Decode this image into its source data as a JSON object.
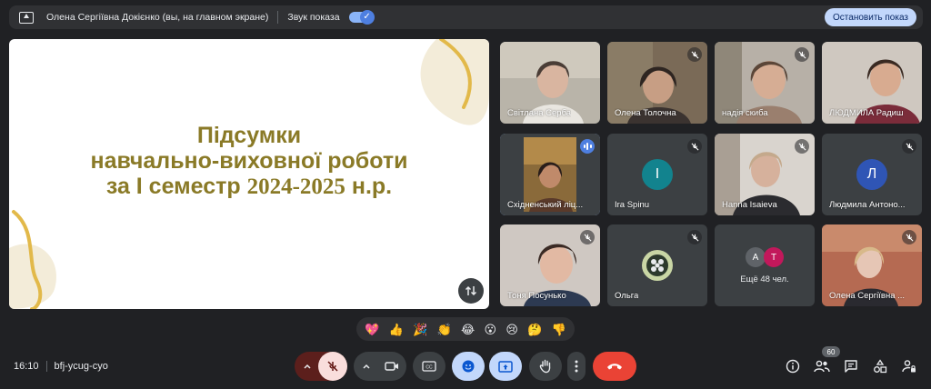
{
  "topbar": {
    "title": "Олена Сергіївна Докієнко (вы, на главном экране)",
    "sound_label": "Звук показа",
    "stop_button": "Остановить показ"
  },
  "slide": {
    "line1": "Підсумки",
    "line2": "навчально-виховної роботи",
    "line3_a": "за І семестр ",
    "line3_year": "2024-2025",
    "line3_b": " н.р.",
    "text_color": "#8a7a27",
    "accent_color": "#e2b94a"
  },
  "participants": [
    {
      "name": "Світлана Серба",
      "muted": false
    },
    {
      "name": "Олена Толочна",
      "muted": true
    },
    {
      "name": "надія скиба",
      "muted": true
    },
    {
      "name": "ЛЮДМИЛА Радиш",
      "muted": false
    },
    {
      "name": "Східненський ліц...",
      "muted": false,
      "speaking": true
    },
    {
      "name": "Ira Spinu",
      "muted": true,
      "initial": "I"
    },
    {
      "name": "Hanna Isaieva",
      "muted": true
    },
    {
      "name": "Людмила Антоно...",
      "muted": true,
      "initial": "Л"
    },
    {
      "name": "Тоня Посунько",
      "muted": true
    },
    {
      "name": "Ольга",
      "muted": true
    },
    {
      "name": "Ещё 48 чел.",
      "initials": [
        "А",
        "Т"
      ]
    },
    {
      "name": "Олена Сергіївна ...",
      "muted": true
    }
  ],
  "reactions": [
    "💖",
    "👍",
    "🎉",
    "👏",
    "😂",
    "😮",
    "😢",
    "🤔",
    "👎"
  ],
  "bottom": {
    "time": "16:10",
    "meeting_code": "bfj-ycug-cyo",
    "people_count": "60"
  },
  "colors": {
    "background": "#202124",
    "tile": "#3c4043",
    "accent_blue": "#8ab4f8",
    "end_call": "#ea4335",
    "mic_off_bg": "#f9dedc"
  }
}
